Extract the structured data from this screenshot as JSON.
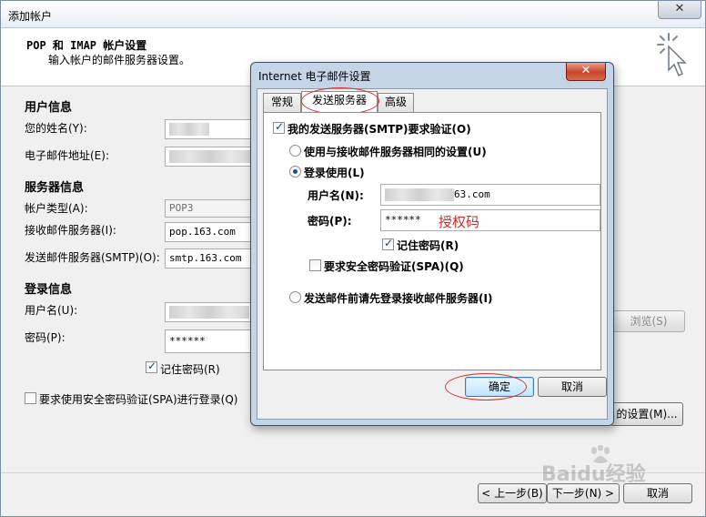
{
  "window": {
    "title": "添加帐户",
    "close_glyph": "✕",
    "header_title": "POP 和 IMAP 帐户设置",
    "header_subtitle": "输入帐户的邮件服务器设置。"
  },
  "form": {
    "user_info_heading": "用户信息",
    "name_label": "您的姓名(Y):",
    "email_label": "电子邮件地址(E):",
    "server_info_heading": "服务器信息",
    "account_type_label": "帐户类型(A):",
    "account_type_value": "POP3",
    "incoming_label": "接收邮件服务器(I):",
    "incoming_value": "pop.163.com",
    "outgoing_label": "发送邮件服务器(SMTP)(O):",
    "outgoing_value": "smtp.163.com",
    "login_heading": "登录信息",
    "username_label": "用户名(U):",
    "password_label": "密码(P):",
    "password_value": "******",
    "remember_password_label": "记住密码(R)",
    "spa_label": "要求使用安全密码验证(SPA)进行登录(Q)",
    "browse_button": "浏览(S)",
    "more_settings_button": "的设置(M)..."
  },
  "footer": {
    "back_button": "< 上一步(B)",
    "next_button": "下一步(N) >",
    "cancel_button": "取消"
  },
  "dialog": {
    "title": "Internet 电子邮件设置",
    "close_glyph": "✕",
    "tabs": [
      {
        "label": "常规"
      },
      {
        "label": "发送服务器"
      },
      {
        "label": "高级"
      }
    ],
    "smtp_auth_label": "我的发送服务器(SMTP)要求验证(O)",
    "same_settings_label": "使用与接收邮件服务器相同的设置(U)",
    "login_using_label": "登录使用(L)",
    "username_label": "用户名(N):",
    "username_suffix": "63.com",
    "password_label": "密码(P):",
    "password_value": "******",
    "annotation": "授权码",
    "remember_password_label": "记住密码(R)",
    "spa_label": "要求安全密码验证(SPA)(Q)",
    "login_before_send_label": "发送邮件前请先登录接收邮件服务器(I)",
    "ok_button": "确定",
    "cancel_button": "取消"
  },
  "watermark": {
    "text": "Baidu经验"
  },
  "colors": {
    "annotation_red": "#d9322e",
    "dialog_frame": "#c5d4e6",
    "close_red": "#c7452a"
  }
}
